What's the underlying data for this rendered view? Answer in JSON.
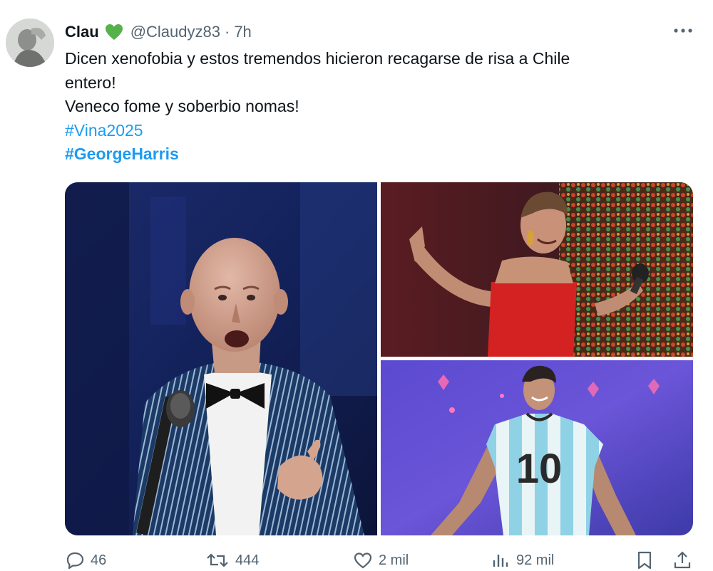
{
  "user": {
    "display_name": "Clau",
    "handle": "@Claudyz83",
    "separator": "·",
    "time_ago": "7h",
    "badge_icon": "green-heart-icon",
    "badge_color": "#56b14a"
  },
  "tweet": {
    "line1": "Dicen xenofobia y estos tremendos hicieron recagarse de risa a Chile",
    "line2": "entero!",
    "line3": "Veneco fome y soberbio nomas!",
    "hashtags": [
      "#Vina2025",
      "#GeorgeHarris"
    ]
  },
  "media": {
    "jersey_number": "10"
  },
  "actions": {
    "replies": "46",
    "reposts": "444",
    "likes": "2 mil",
    "views": "92 mil"
  },
  "colors": {
    "text": "#0f1419",
    "secondary": "#536471",
    "link": "#1d9bf0"
  }
}
